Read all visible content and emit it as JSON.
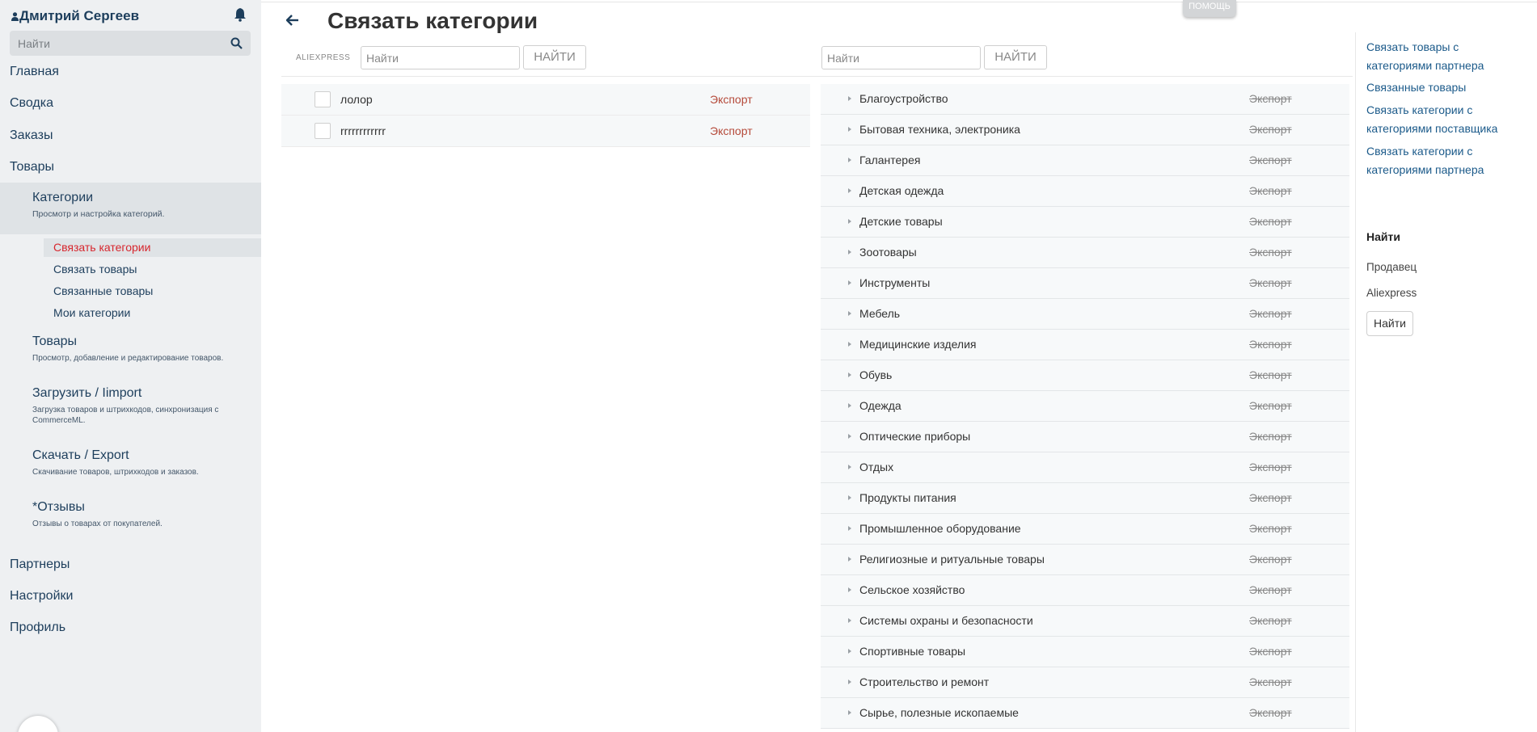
{
  "sidebar": {
    "user_name": "Дмитрий Сергеев",
    "search_placeholder": "Найти",
    "nav_top": [
      "Главная",
      "Сводка",
      "Заказы",
      "Товары"
    ],
    "categories": {
      "title": "Категории",
      "desc": "Просмотр и настройка категорий."
    },
    "sub_items": [
      "Связать категории",
      "Связать товары",
      "Связанные товары",
      "Мои категории"
    ],
    "sections": [
      {
        "title": "Товары",
        "desc": "Просмотр, добавление и редактирование товаров."
      },
      {
        "title": "Загрузить / Iimport",
        "desc": "Загрузка товаров и штрихкодов, синхронизация с CommerceML."
      },
      {
        "title": "Скачать / Export",
        "desc": "Скачивание товаров, штрихкодов и заказов."
      },
      {
        "title": "*Отзывы",
        "desc": "Отзывы о товарах от покупателей."
      }
    ],
    "nav_bottom": [
      "Партнеры",
      "Настройки",
      "Профиль"
    ]
  },
  "header": {
    "title": "Связать категории",
    "help_label": "Помощь"
  },
  "left_panel": {
    "source_label": "ALIEXPRESS",
    "search_placeholder": "Найти",
    "search_button": "НАЙТИ",
    "rows": [
      {
        "name": "лолор",
        "export": "Экспорт"
      },
      {
        "name": "rrrrrrrrrrrr",
        "export": "Экспорт"
      }
    ]
  },
  "right_list": {
    "search_placeholder": "Найти",
    "search_button": "НАЙТИ",
    "export_label": "Экспорт",
    "rows": [
      "Благоустройство",
      "Бытовая техника, электроника",
      "Галантерея",
      "Детская одежда",
      "Детские товары",
      "Зоотовары",
      "Инструменты",
      "Мебель",
      "Медицинские изделия",
      "Обувь",
      "Одежда",
      "Оптические приборы",
      "Отдых",
      "Продукты питания",
      "Промышленное оборудование",
      "Религиозные и ритуальные товары",
      "Сельское хозяйство",
      "Системы охраны и безопасности",
      "Спортивные товары",
      "Строительство и ремонт",
      "Сырье, полезные ископаемые"
    ]
  },
  "right_panel": {
    "links": [
      "Связать товары с категориями партнера",
      "Связанные товары",
      "Связать категории с категориями поставщика",
      "Связать категории с категориями партнера"
    ],
    "find_title": "Найти",
    "filter_seller": "Продавец",
    "filter_source": "Aliexpress",
    "find_button": "Найти"
  },
  "colors": {
    "sidebar_bg": "#eef0f2",
    "nav_text": "#1d3e5c",
    "active_red": "#d7262d",
    "export_red": "#b54a3a",
    "link_blue": "#1b5a8a"
  }
}
